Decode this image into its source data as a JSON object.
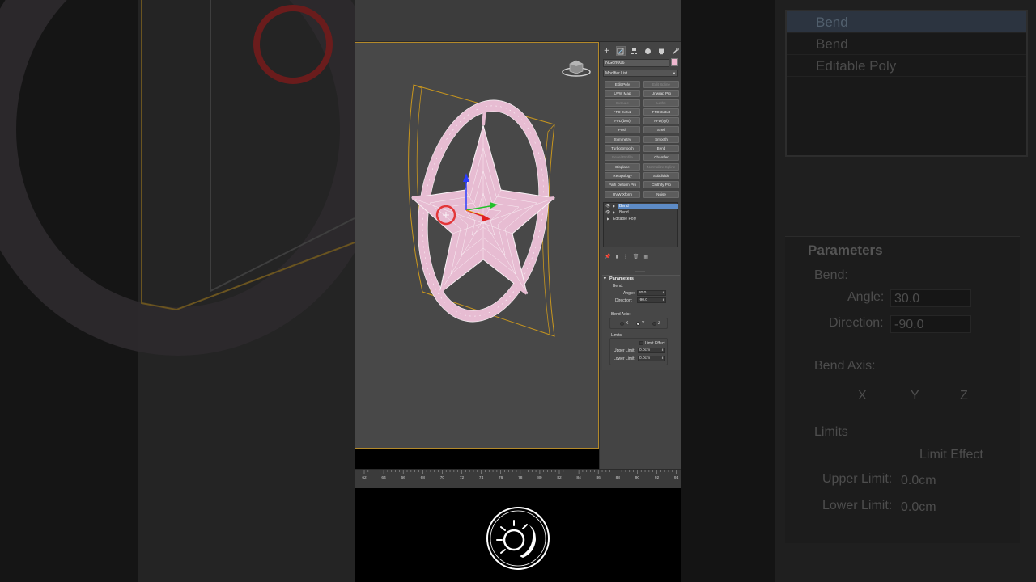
{
  "object_name": "NGon006",
  "object_color": "#f0b8d0",
  "modifier_list_label": "Modifier List",
  "modifier_buttons": [
    {
      "label": "Edit Poly",
      "enabled": true
    },
    {
      "label": "Edit Spline",
      "enabled": false
    },
    {
      "label": "UVW Map",
      "enabled": true
    },
    {
      "label": "Unwrap Pro",
      "enabled": true
    },
    {
      "label": "Extrude",
      "enabled": false
    },
    {
      "label": "Lathe",
      "enabled": false
    },
    {
      "label": "FFD 2x2x2",
      "enabled": true
    },
    {
      "label": "FFD 3x3x3",
      "enabled": true
    },
    {
      "label": "FFD(box)",
      "enabled": true
    },
    {
      "label": "FFD(cyl)",
      "enabled": true
    },
    {
      "label": "Push",
      "enabled": true
    },
    {
      "label": "Shell",
      "enabled": true
    },
    {
      "label": "Symmetry",
      "enabled": true
    },
    {
      "label": "Smooth",
      "enabled": true
    },
    {
      "label": "TurboSmooth",
      "enabled": true
    },
    {
      "label": "Bend",
      "enabled": true
    },
    {
      "label": "Bevel Profile",
      "enabled": false
    },
    {
      "label": "Chamfer",
      "enabled": true
    },
    {
      "label": "Displace",
      "enabled": true
    },
    {
      "label": "Normalize Spline",
      "enabled": false
    },
    {
      "label": "Retopology",
      "enabled": true
    },
    {
      "label": "Subdivide",
      "enabled": true
    },
    {
      "label": "Path Deform Pro",
      "enabled": true
    },
    {
      "label": "Clothify Pro",
      "enabled": true
    },
    {
      "label": "UVW Xform",
      "enabled": true
    },
    {
      "label": "Noise",
      "enabled": true
    }
  ],
  "stack": [
    {
      "label": "Bend",
      "selected": true,
      "eye": true
    },
    {
      "label": "Bend",
      "selected": false,
      "eye": true
    },
    {
      "label": "Editable Poly",
      "selected": false,
      "eye": false
    }
  ],
  "parameters": {
    "rollout_title": "Parameters",
    "bend_label": "Bend:",
    "angle_label": "Angle:",
    "angle_value": "30.0",
    "direction_label": "Direction:",
    "direction_value": "-90.0",
    "bend_axis_label": "Bend Axis:",
    "axis_x": "X",
    "axis_y": "Y",
    "axis_z": "Z",
    "selected_axis": "Y",
    "limits_label": "Limits",
    "limit_effect_label": "Limit Effect",
    "upper_limit_label": "Upper Limit:",
    "upper_limit_value": "0.0cm",
    "lower_limit_label": "Lower Limit:",
    "lower_limit_value": "0.0cm"
  },
  "timeline_ticks": [
    "62",
    "64",
    "66",
    "68",
    "70",
    "72",
    "74",
    "76",
    "78",
    "80",
    "82",
    "84",
    "86",
    "88",
    "90",
    "92",
    "94"
  ],
  "colors": {
    "viewport_bg": "#484848",
    "selection_frame": "#c8961e",
    "mesh": "#e7bcd2",
    "selected_stack_item": "#5d8bc6"
  }
}
